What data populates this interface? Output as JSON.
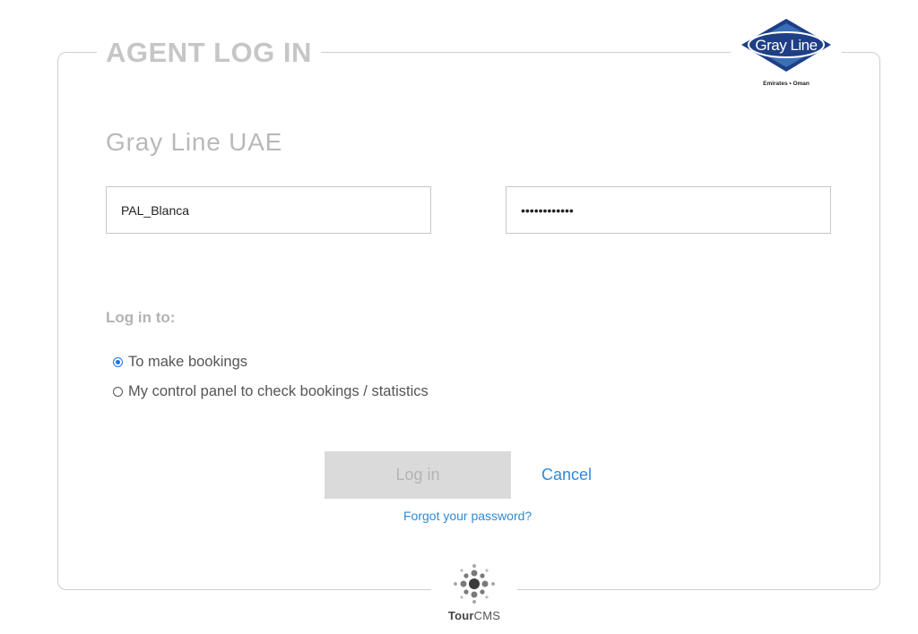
{
  "form": {
    "legend": "AGENT LOG IN",
    "agency_name": "Gray Line UAE",
    "username_value": "PAL_Blanca",
    "password_value": "••••••••••••",
    "login_to_label": "Log in to:",
    "options": [
      {
        "label": "To make bookings",
        "selected": true
      },
      {
        "label": "My control panel to check bookings / statistics",
        "selected": false
      }
    ],
    "login_button": "Log in",
    "cancel_link": "Cancel",
    "forgot_link": "Forgot your password?"
  },
  "logo": {
    "text": "Gray Line",
    "tagline": "Emirates • Oman",
    "colors": {
      "outer": "#1e3f86",
      "inner": "#3a6fb8",
      "text": "#ffffff"
    }
  },
  "footer": {
    "brand_bold": "Tour",
    "brand_rest": "CMS"
  },
  "colors": {
    "link": "#2f8bd3",
    "radio_accent": "#1a73e8",
    "muted_text": "#b9b9b9",
    "button_bg": "#dadada"
  }
}
